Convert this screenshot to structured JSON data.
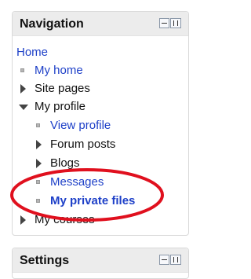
{
  "navigation": {
    "title": "Navigation",
    "home": "Home",
    "my_home": "My home",
    "site_pages": "Site pages",
    "my_profile": "My profile",
    "view_profile": "View profile",
    "forum_posts": "Forum posts",
    "blogs": "Blogs",
    "messages": "Messages",
    "my_private_files": "My private files",
    "my_courses": "My courses"
  },
  "settings": {
    "title": "Settings"
  },
  "colors": {
    "link": "#1e40c8",
    "annotation": "#e0101e",
    "header_bg": "#ececec"
  }
}
